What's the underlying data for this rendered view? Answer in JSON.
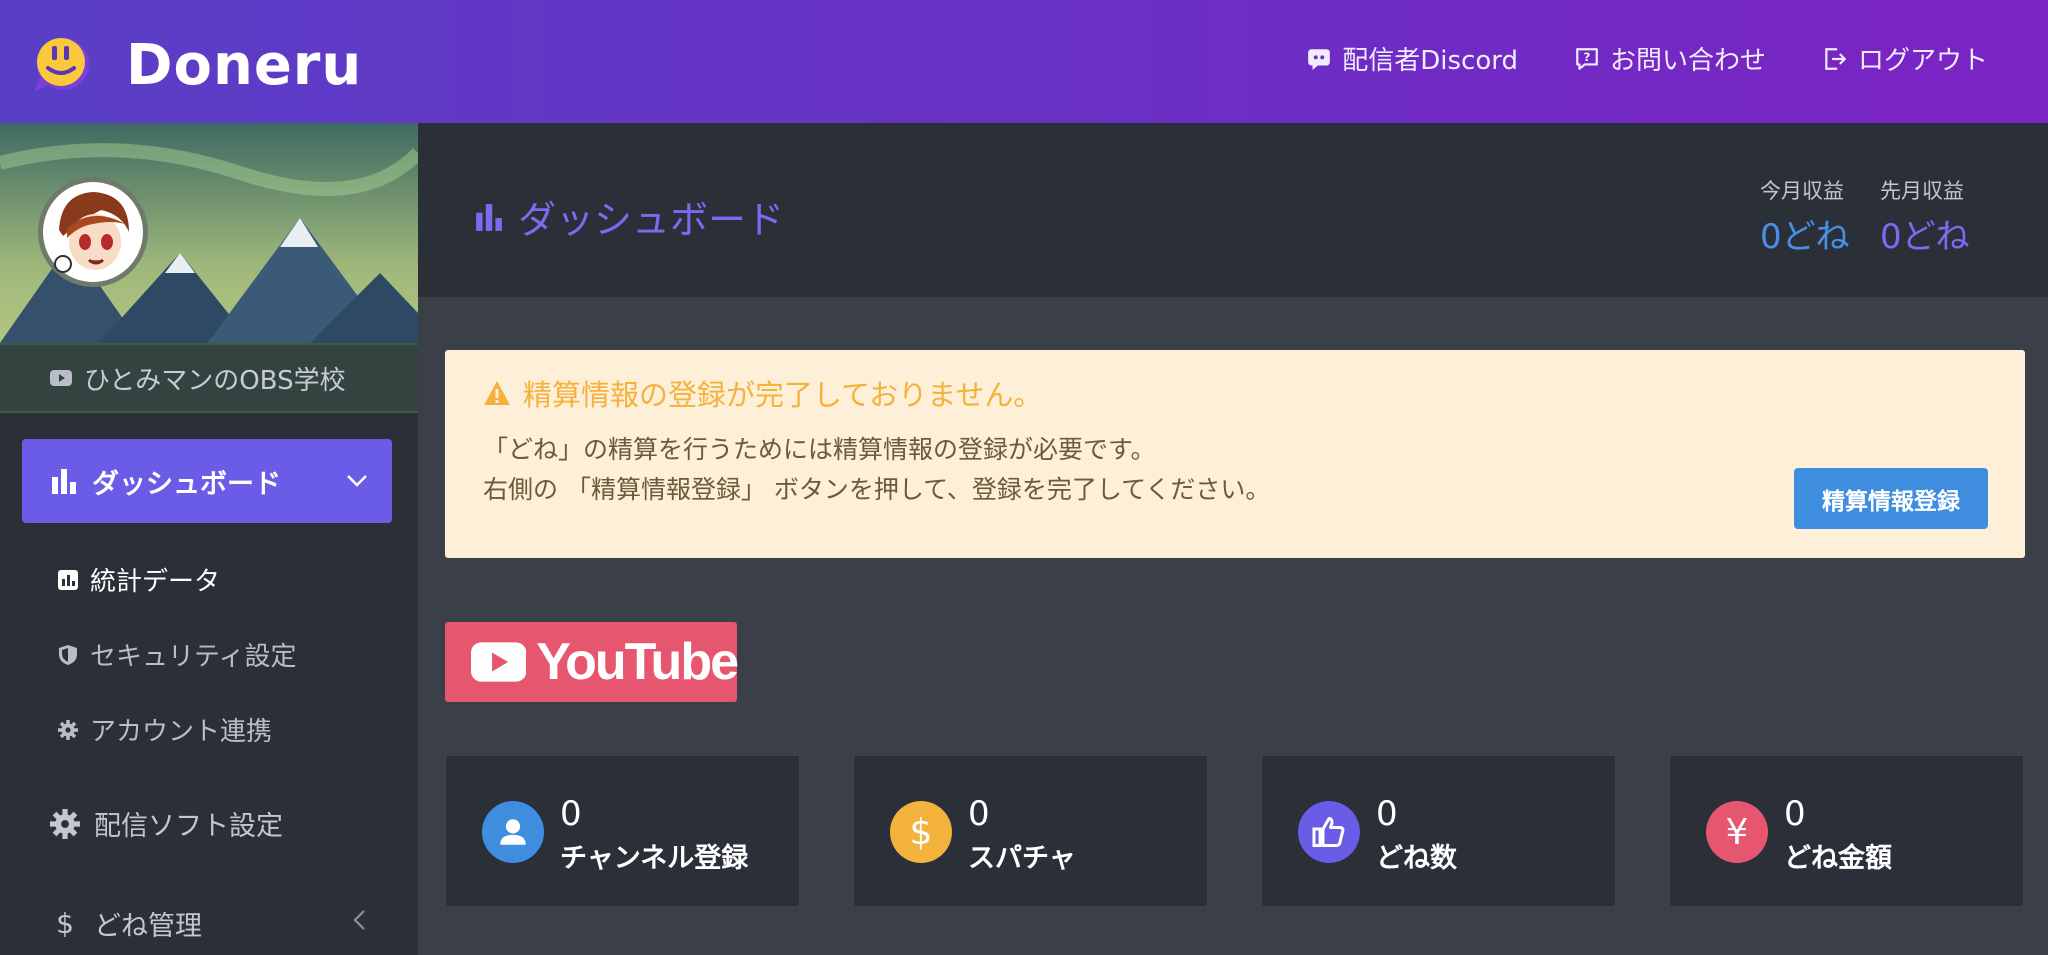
{
  "header": {
    "logo_text": "Doneru",
    "nav": [
      {
        "label": "配信者Discord",
        "icon": "discord-icon"
      },
      {
        "label": "お問い合わせ",
        "icon": "question-bubble-icon"
      },
      {
        "label": "ログアウト",
        "icon": "logout-icon"
      }
    ]
  },
  "sidebar": {
    "channel_name": "ひとみマンのOBS学校",
    "active_menu": {
      "label": "ダッシュボード"
    },
    "submenu": [
      {
        "label": "統計データ"
      },
      {
        "label": "セキュリティ設定"
      },
      {
        "label": "アカウント連携"
      }
    ],
    "menu": [
      {
        "label": "配信ソフト設定"
      },
      {
        "label": "どね管理"
      }
    ]
  },
  "page": {
    "title": "ダッシュボード",
    "revenue": [
      {
        "label": "今月収益",
        "value": "0どね"
      },
      {
        "label": "先月収益",
        "value": "0どね"
      }
    ]
  },
  "alert": {
    "title": "精算情報の登録が完了しておりません。",
    "line1": "「どね」の精算を行うためには精算情報の登録が必要です。",
    "line2": "右側の 「精算情報登録」 ボタンを押して、登録を完了してください。",
    "button": "精算情報登録"
  },
  "platform": {
    "label": "YouTube"
  },
  "stats": [
    {
      "value": "0",
      "label": "チャンネル登録",
      "icon": "user-icon",
      "color": "#3f8ddf"
    },
    {
      "value": "0",
      "label": "スパチャ",
      "icon": "dollar-icon",
      "color": "#f2b23c"
    },
    {
      "value": "0",
      "label": "どね数",
      "icon": "thumbs-up-icon",
      "color": "#6b5ce7"
    },
    {
      "value": "0",
      "label": "どね金額",
      "icon": "yen-icon",
      "color": "#e6566f"
    }
  ],
  "colors": {
    "header_gradient_start": "#5a3fc6",
    "header_gradient_end": "#7b23c3",
    "accent_purple": "#6b5ce7",
    "accent_blue": "#3f8ddf",
    "warning_bg": "#fdefd8",
    "warning_text": "#f4b23d",
    "sidebar_bg": "#2a2f38",
    "main_bg": "#3a3f48"
  }
}
